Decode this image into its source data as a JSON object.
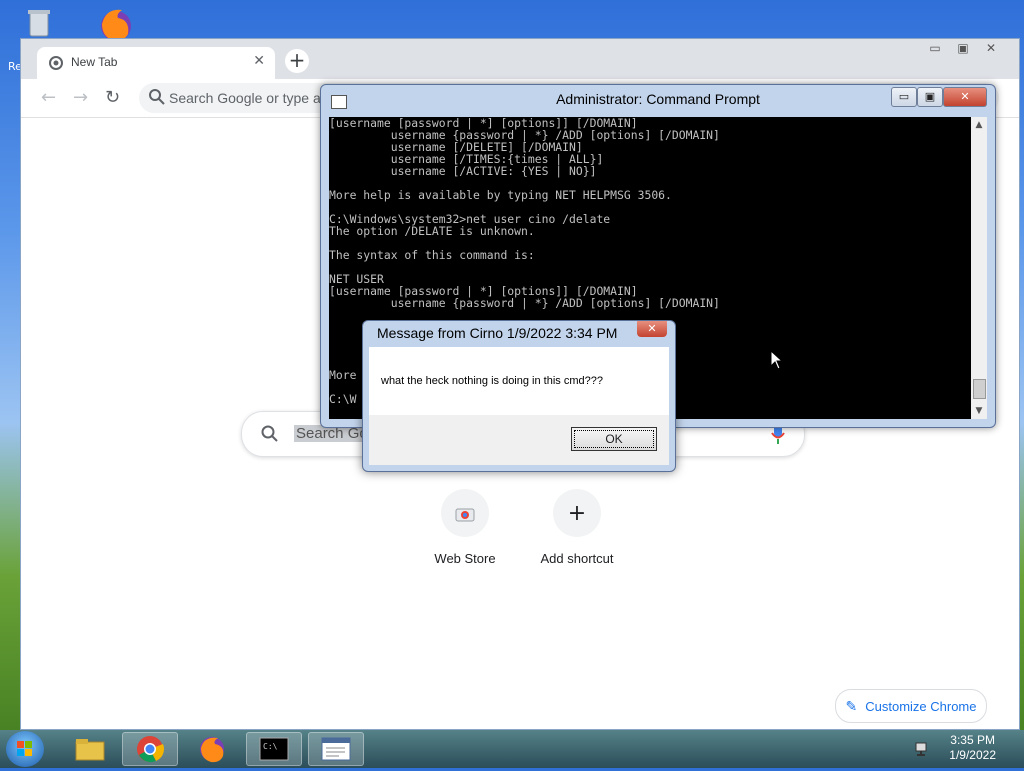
{
  "desktop": {
    "recycle_label": "Re"
  },
  "chrome": {
    "tab_title": "New Tab",
    "omnibox_placeholder": "Search Google or type a URL",
    "search_placeholder": "Search Google or type a URL",
    "shortcuts": [
      {
        "label": "Web Store",
        "icon": "web-store-icon"
      },
      {
        "label": "Add shortcut",
        "icon": "plus-icon"
      }
    ],
    "customize_label": "Customize Chrome"
  },
  "cmd": {
    "title": "Administrator: Command Prompt",
    "lines": [
      "[username [password | *] [options]] [/DOMAIN]",
      "         username {password | *} /ADD [options] [/DOMAIN]",
      "         username [/DELETE] [/DOMAIN]",
      "         username [/TIMES:{times | ALL}]",
      "         username [/ACTIVE: {YES | NO}]",
      "",
      "More help is available by typing NET HELPMSG 3506.",
      "",
      "C:\\Windows\\system32>net user cino /delate",
      "The option /DELATE is unknown.",
      "",
      "The syntax of this command is:",
      "",
      "NET USER",
      "[username [password | *] [options]] [/DOMAIN]",
      "         username {password | *} /ADD [options] [/DOMAIN]",
      "",
      "",
      "",
      "",
      "",
      "More help is available by typing NET HELPMSG 3506.",
      "",
      "C:\\W"
    ]
  },
  "message": {
    "title": "Message from Cirno 1/9/2022 3:34 PM",
    "text": "what the heck nothing is doing in this cmd???",
    "ok_label": "OK"
  },
  "taskbar": {
    "items": [
      "explorer",
      "chrome",
      "firefox",
      "cmd",
      "notepad"
    ],
    "time": "3:35 PM",
    "date": "1/9/2022"
  }
}
